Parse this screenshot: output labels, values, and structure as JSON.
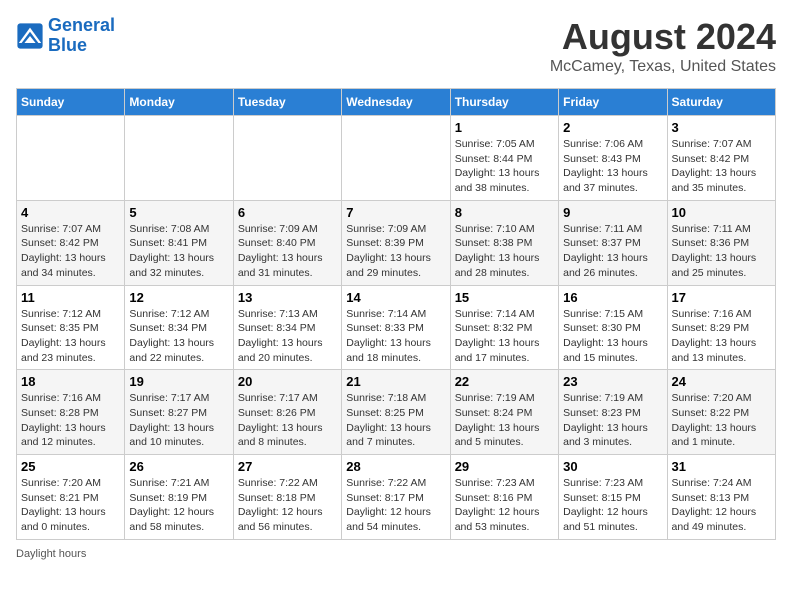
{
  "header": {
    "logo_line1": "General",
    "logo_line2": "Blue",
    "month": "August 2024",
    "location": "McCamey, Texas, United States"
  },
  "weekdays": [
    "Sunday",
    "Monday",
    "Tuesday",
    "Wednesday",
    "Thursday",
    "Friday",
    "Saturday"
  ],
  "weeks": [
    [
      {
        "day": "",
        "sunrise": "",
        "sunset": "",
        "daylight": ""
      },
      {
        "day": "",
        "sunrise": "",
        "sunset": "",
        "daylight": ""
      },
      {
        "day": "",
        "sunrise": "",
        "sunset": "",
        "daylight": ""
      },
      {
        "day": "",
        "sunrise": "",
        "sunset": "",
        "daylight": ""
      },
      {
        "day": "1",
        "sunrise": "Sunrise: 7:05 AM",
        "sunset": "Sunset: 8:44 PM",
        "daylight": "Daylight: 13 hours and 38 minutes."
      },
      {
        "day": "2",
        "sunrise": "Sunrise: 7:06 AM",
        "sunset": "Sunset: 8:43 PM",
        "daylight": "Daylight: 13 hours and 37 minutes."
      },
      {
        "day": "3",
        "sunrise": "Sunrise: 7:07 AM",
        "sunset": "Sunset: 8:42 PM",
        "daylight": "Daylight: 13 hours and 35 minutes."
      }
    ],
    [
      {
        "day": "4",
        "sunrise": "Sunrise: 7:07 AM",
        "sunset": "Sunset: 8:42 PM",
        "daylight": "Daylight: 13 hours and 34 minutes."
      },
      {
        "day": "5",
        "sunrise": "Sunrise: 7:08 AM",
        "sunset": "Sunset: 8:41 PM",
        "daylight": "Daylight: 13 hours and 32 minutes."
      },
      {
        "day": "6",
        "sunrise": "Sunrise: 7:09 AM",
        "sunset": "Sunset: 8:40 PM",
        "daylight": "Daylight: 13 hours and 31 minutes."
      },
      {
        "day": "7",
        "sunrise": "Sunrise: 7:09 AM",
        "sunset": "Sunset: 8:39 PM",
        "daylight": "Daylight: 13 hours and 29 minutes."
      },
      {
        "day": "8",
        "sunrise": "Sunrise: 7:10 AM",
        "sunset": "Sunset: 8:38 PM",
        "daylight": "Daylight: 13 hours and 28 minutes."
      },
      {
        "day": "9",
        "sunrise": "Sunrise: 7:11 AM",
        "sunset": "Sunset: 8:37 PM",
        "daylight": "Daylight: 13 hours and 26 minutes."
      },
      {
        "day": "10",
        "sunrise": "Sunrise: 7:11 AM",
        "sunset": "Sunset: 8:36 PM",
        "daylight": "Daylight: 13 hours and 25 minutes."
      }
    ],
    [
      {
        "day": "11",
        "sunrise": "Sunrise: 7:12 AM",
        "sunset": "Sunset: 8:35 PM",
        "daylight": "Daylight: 13 hours and 23 minutes."
      },
      {
        "day": "12",
        "sunrise": "Sunrise: 7:12 AM",
        "sunset": "Sunset: 8:34 PM",
        "daylight": "Daylight: 13 hours and 22 minutes."
      },
      {
        "day": "13",
        "sunrise": "Sunrise: 7:13 AM",
        "sunset": "Sunset: 8:34 PM",
        "daylight": "Daylight: 13 hours and 20 minutes."
      },
      {
        "day": "14",
        "sunrise": "Sunrise: 7:14 AM",
        "sunset": "Sunset: 8:33 PM",
        "daylight": "Daylight: 13 hours and 18 minutes."
      },
      {
        "day": "15",
        "sunrise": "Sunrise: 7:14 AM",
        "sunset": "Sunset: 8:32 PM",
        "daylight": "Daylight: 13 hours and 17 minutes."
      },
      {
        "day": "16",
        "sunrise": "Sunrise: 7:15 AM",
        "sunset": "Sunset: 8:30 PM",
        "daylight": "Daylight: 13 hours and 15 minutes."
      },
      {
        "day": "17",
        "sunrise": "Sunrise: 7:16 AM",
        "sunset": "Sunset: 8:29 PM",
        "daylight": "Daylight: 13 hours and 13 minutes."
      }
    ],
    [
      {
        "day": "18",
        "sunrise": "Sunrise: 7:16 AM",
        "sunset": "Sunset: 8:28 PM",
        "daylight": "Daylight: 13 hours and 12 minutes."
      },
      {
        "day": "19",
        "sunrise": "Sunrise: 7:17 AM",
        "sunset": "Sunset: 8:27 PM",
        "daylight": "Daylight: 13 hours and 10 minutes."
      },
      {
        "day": "20",
        "sunrise": "Sunrise: 7:17 AM",
        "sunset": "Sunset: 8:26 PM",
        "daylight": "Daylight: 13 hours and 8 minutes."
      },
      {
        "day": "21",
        "sunrise": "Sunrise: 7:18 AM",
        "sunset": "Sunset: 8:25 PM",
        "daylight": "Daylight: 13 hours and 7 minutes."
      },
      {
        "day": "22",
        "sunrise": "Sunrise: 7:19 AM",
        "sunset": "Sunset: 8:24 PM",
        "daylight": "Daylight: 13 hours and 5 minutes."
      },
      {
        "day": "23",
        "sunrise": "Sunrise: 7:19 AM",
        "sunset": "Sunset: 8:23 PM",
        "daylight": "Daylight: 13 hours and 3 minutes."
      },
      {
        "day": "24",
        "sunrise": "Sunrise: 7:20 AM",
        "sunset": "Sunset: 8:22 PM",
        "daylight": "Daylight: 13 hours and 1 minute."
      }
    ],
    [
      {
        "day": "25",
        "sunrise": "Sunrise: 7:20 AM",
        "sunset": "Sunset: 8:21 PM",
        "daylight": "Daylight: 13 hours and 0 minutes."
      },
      {
        "day": "26",
        "sunrise": "Sunrise: 7:21 AM",
        "sunset": "Sunset: 8:19 PM",
        "daylight": "Daylight: 12 hours and 58 minutes."
      },
      {
        "day": "27",
        "sunrise": "Sunrise: 7:22 AM",
        "sunset": "Sunset: 8:18 PM",
        "daylight": "Daylight: 12 hours and 56 minutes."
      },
      {
        "day": "28",
        "sunrise": "Sunrise: 7:22 AM",
        "sunset": "Sunset: 8:17 PM",
        "daylight": "Daylight: 12 hours and 54 minutes."
      },
      {
        "day": "29",
        "sunrise": "Sunrise: 7:23 AM",
        "sunset": "Sunset: 8:16 PM",
        "daylight": "Daylight: 12 hours and 53 minutes."
      },
      {
        "day": "30",
        "sunrise": "Sunrise: 7:23 AM",
        "sunset": "Sunset: 8:15 PM",
        "daylight": "Daylight: 12 hours and 51 minutes."
      },
      {
        "day": "31",
        "sunrise": "Sunrise: 7:24 AM",
        "sunset": "Sunset: 8:13 PM",
        "daylight": "Daylight: 12 hours and 49 minutes."
      }
    ]
  ],
  "footer": {
    "note": "Daylight hours"
  }
}
